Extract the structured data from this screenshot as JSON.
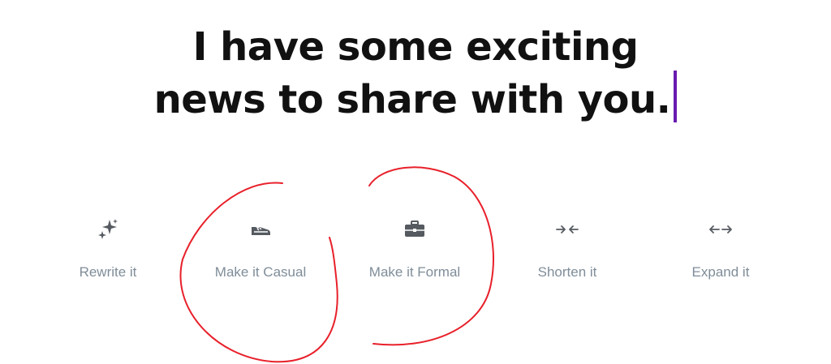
{
  "headline": {
    "line1": "I have some exciting",
    "line2": "news to share with you."
  },
  "actions": [
    {
      "label": "Rewrite it",
      "icon": "sparkles-icon"
    },
    {
      "label": "Make it Casual",
      "icon": "sneaker-icon"
    },
    {
      "label": "Make it Formal",
      "icon": "briefcase-icon"
    },
    {
      "label": "Shorten it",
      "icon": "arrows-inward-icon"
    },
    {
      "label": "Expand it",
      "icon": "arrows-outward-icon"
    }
  ],
  "colors": {
    "text": "#111111",
    "cursor": "#6a1bb0",
    "label": "#7f8d99",
    "icon": "#555a60",
    "annotation": "#e8202a"
  }
}
